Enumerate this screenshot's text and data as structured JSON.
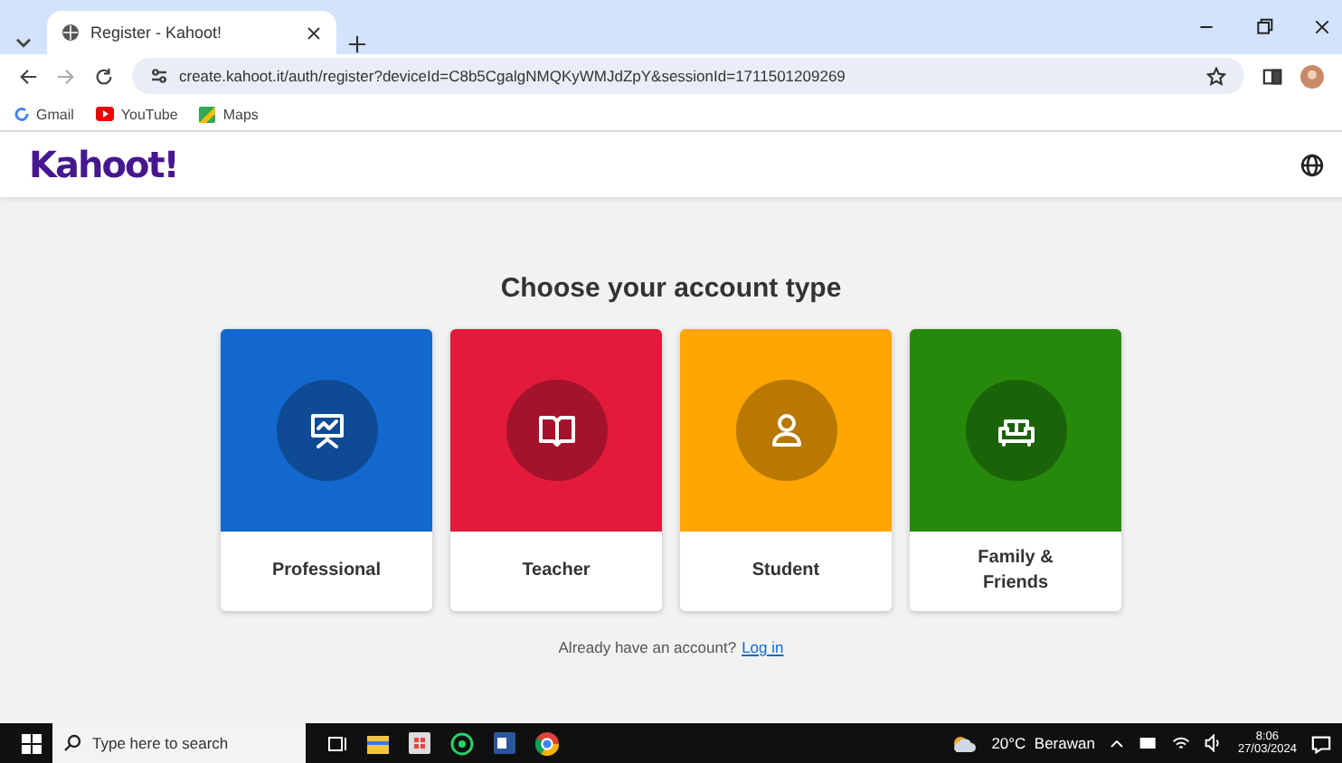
{
  "browser": {
    "tabs": [
      {
        "title": "Register - Kahoot!",
        "selected": true
      }
    ],
    "url": "create.kahoot.it/auth/register?deviceId=C8b5CgalgNMQKyWMJdZpY&sessionId=1711501209269",
    "bookmarks": [
      {
        "label": "Gmail",
        "kind": "google"
      },
      {
        "label": "YouTube",
        "kind": "youtube"
      },
      {
        "label": "Maps",
        "kind": "maps"
      }
    ]
  },
  "page": {
    "logo": "Kahoot!",
    "title": "Choose your account type",
    "cards": [
      {
        "label": "Professional",
        "kind": "presentation",
        "color": "#1368ce"
      },
      {
        "label": "Teacher",
        "kind": "book",
        "color": "#e21b3c"
      },
      {
        "label": "Student",
        "kind": "person",
        "color": "#ffa602"
      },
      {
        "label": "Family & Friends",
        "kind": "sofa",
        "color": "#26890c"
      }
    ],
    "login_prompt": "Already have an account?",
    "login_link": "Log in"
  },
  "taskbar": {
    "search_placeholder": "Type here to search",
    "weather": "20°C  Berawan",
    "time": "8:06",
    "date": "27/03/2024"
  }
}
